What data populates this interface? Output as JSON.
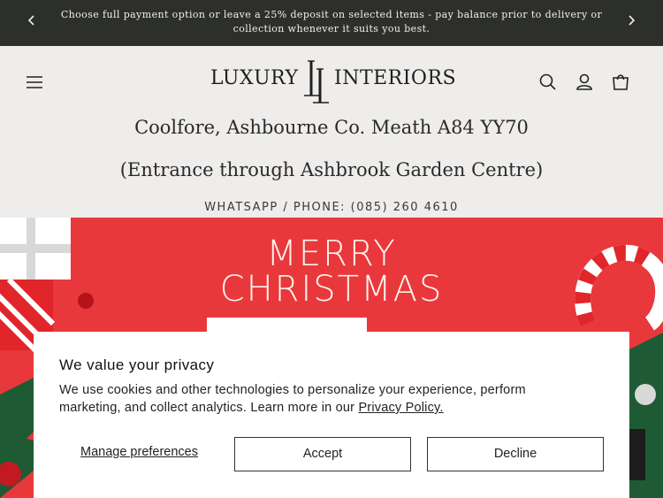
{
  "announcement": {
    "text": "Choose full payment option or leave a 25% deposit on selected items - pay balance prior to delivery or collection whenever it suits you best.",
    "prev_icon": "chevron-left-icon",
    "next_icon": "chevron-right-icon"
  },
  "header": {
    "logo_left": "LUXURY",
    "logo_right": "INTERIORS",
    "menu_icon": "hamburger-menu-icon",
    "search_icon": "search-icon",
    "account_icon": "account-icon",
    "cart_icon": "cart-icon",
    "address_line1": "Coolfore, Ashbourne Co. Meath A84 YY70",
    "address_line2": "(Entrance through Ashbrook Garden Centre)",
    "phone": "WHATSAPP / PHONE: (085) 260 4610"
  },
  "banner": {
    "line1": "MERRY",
    "line2": "CHRISTMAS",
    "color": "#e8383b"
  },
  "cookie": {
    "title": "We value your privacy",
    "body": "We use cookies and other technologies to personalize your experience, perform marketing, and collect analytics. Learn more in our",
    "link": "Privacy Policy.",
    "manage": "Manage preferences",
    "accept": "Accept",
    "decline": "Decline"
  }
}
